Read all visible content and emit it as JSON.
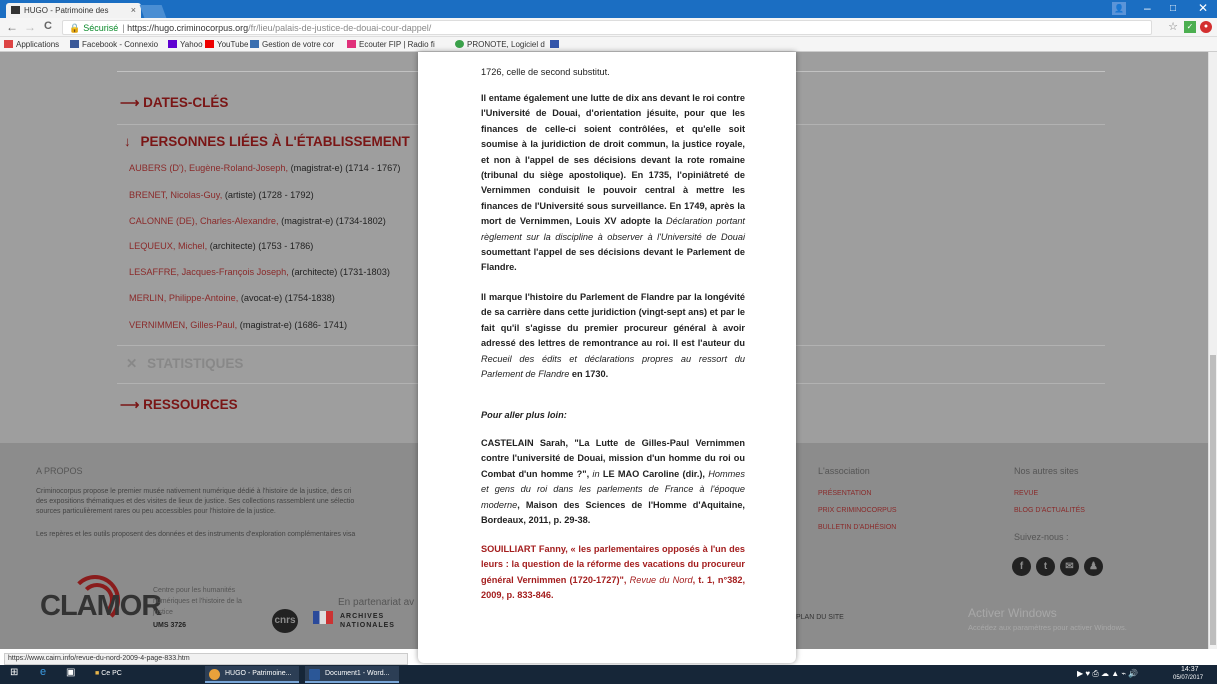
{
  "browser": {
    "tab_title": "HUGO - Patrimoine des",
    "tab_close": "×",
    "url_secure_label": "Sécurisé",
    "url_base": "https://hugo.criminocorpus.org",
    "url_path": "/fr/lieu/palais-de-justice-de-douai-cour-dappel/",
    "window_controls": [
      "–",
      "□",
      "✕"
    ],
    "profile_label": "👤",
    "nav": {
      "back": "←",
      "forward": "→",
      "reload": "C"
    },
    "bookmarks": [
      {
        "label": "Applications",
        "color": "#d44"
      },
      {
        "label": "Facebook - Connexio",
        "color": "#3b5998"
      },
      {
        "label": "Yahoo",
        "color": "#5f01d1"
      },
      {
        "label": "YouTube",
        "color": "#e00"
      },
      {
        "label": "Gestion de votre cor",
        "color": "#3a6fb0"
      },
      {
        "label": "Ecouter FIP | Radio fi",
        "color": "#e0307a"
      },
      {
        "label": "PRONOTE, Logiciel d",
        "color": "#3aa14a"
      },
      {
        "label": "",
        "color": "#3355aa"
      }
    ]
  },
  "page": {
    "top_text": "1726, celle de second substitut.",
    "sections": {
      "dates": "DATES-CLÉS",
      "personnes": "PERSONNES LIÉES À L'ÉTABLISSEMENT",
      "statistiques": "STATISTIQUES",
      "ressources": "RESSOURCES"
    },
    "arrows": {
      "right": "⟶",
      "down": "↓",
      "cross": "✕"
    },
    "persons": [
      {
        "name": "AUBERS (D'), Eugène-Roland-Joseph,",
        "role": "(magistrat-e) (1714 - 1767)"
      },
      {
        "name": "BRENET, Nicolas-Guy,",
        "role": "(artiste) (1728 - 1792)"
      },
      {
        "name": "CALONNE (DE), Charles-Alexandre,",
        "role": "(magistrat-e) (1734-1802)"
      },
      {
        "name": "LEQUEUX, Michel,",
        "role": "(architecte) (1753 - 1786)"
      },
      {
        "name": "LESAFFRE, Jacques-François Joseph,",
        "role": "(architecte) (1731-1803)"
      },
      {
        "name": "MERLIN, Philippe-Antoine,",
        "role": "(avocat-e) (1754-1838)"
      },
      {
        "name": "VERNIMMEN, Gilles-Paul,",
        "role": "(magistrat-e) (1686- 1741)"
      }
    ]
  },
  "footer": {
    "apropos_title": "A PROPOS",
    "apropos_text1": "Criminocorpus propose le premier musée nativement numérique dédié à l'histoire de la justice, des cri",
    "apropos_text2": "des expositions thématiques et des visites de lieux de justice. Ses collections rassemblent une sélectio",
    "apropos_text3": "sources particulièrement rares ou peu accessibles pour l'histoire de la justice.",
    "apropos_text4": "Les repères et les outils proposent des données et des instruments d'exploration complémentaires visa",
    "clamor": "CLAMOR",
    "clamor_desc": [
      "Centre pour les humanités",
      "numériques et l'histoire de la",
      "justice"
    ],
    "ums": "UMS 3726",
    "partenariat": "En partenariat av",
    "cnrs": "cnrs",
    "archives": [
      "ARCHIVES",
      "NATIONALES"
    ],
    "plan": "PLAN DU SITE",
    "association_title": "L'association",
    "association_links": [
      "PRÉSENTATION",
      "PRIX CRIMINOCORPUS",
      "BULLETIN D'ADHÉSION"
    ],
    "autres_title": "Nos autres sites",
    "autres_links": [
      "REVUE",
      "BLOG D'ACTUALITÉS"
    ],
    "suivez": "Suivez-nous :",
    "social_icons": [
      "f",
      "t",
      "✉",
      "♟"
    ],
    "activate_title": "Activer Windows",
    "activate_text": "Accédez aux paramètres pour activer Windows."
  },
  "modal": {
    "p1_a": "Il entame également une lutte de dix ans devant le roi contre l'Université de Douai, d'orientation jésuite, pour que les finances de celle-ci soient contrôlées, et qu'elle soit soumise à la juridiction de droit commun, la justice royale, et non à l'appel de ses décisions devant la rote romaine (tribunal du siège apostolique). En 1735, l'opiniâtreté de Vernimmen conduisit le pouvoir central à mettre les finances de l'Université sous surveillance. En 1749, après la mort de Vernimmen, Louis XV adopte la ",
    "p1_i": "Déclaration portant règlement sur la discipline à observer à l'Université de Douai",
    "p1_b": " soumettant l'appel de ses décisions devant le Parlement de Flandre.",
    "p2_a": "Il marque l'histoire du Parlement de Flandre par la longévité de sa carrière dans cette juridiction (vingt-sept ans) et par le fait qu'il s'agisse du premier procureur général à avoir adressé des lettres de remontrance au roi.  Il est l'auteur du ",
    "p2_i": "Recueil des édits et déclarations propres au ressort du Parlement de Flandre",
    "p2_b": " en 1730.",
    "pour_aller": "Pour aller plus loin:",
    "ref1_a": "CASTELAIN Sarah, \"La Lutte de Gilles-Paul Vernimmen contre l'université de Douai, mission d'un homme du roi ou Combat d'un homme ?\", ",
    "ref1_in": "in",
    "ref1_b": " LE MAO Caroline (dir.), ",
    "ref1_i": "Hommes et gens du roi dans les parlements de France à l'époque moderne",
    "ref1_c": ", Maison des Sciences de l'Homme d'Aquitaine, Bordeaux, 2011, p. 29-38.",
    "ref2_a": "SOUILLIART Fanny, « les parlementaires opposés à l'un des leurs : la question de la réforme des vacations du procureur général Vernimmen (1720-1727)\", ",
    "ref2_i": "Revue du Nord",
    "ref2_b": ", t. 1, n°382, 2009, p. 833-846."
  },
  "status_url": "https://www.cairn.info/revue-du-nord-2009-4-page-833.htm",
  "taskbar": {
    "ce_pc": "Ce PC",
    "app1": "HUGO - Patrimoine...",
    "app2": "Document1 - Word...",
    "time": "14:37",
    "date": "05/07/2017",
    "tray": "▶ ♥ ⎙ ☁ ▲ ⌁ 🔊"
  }
}
